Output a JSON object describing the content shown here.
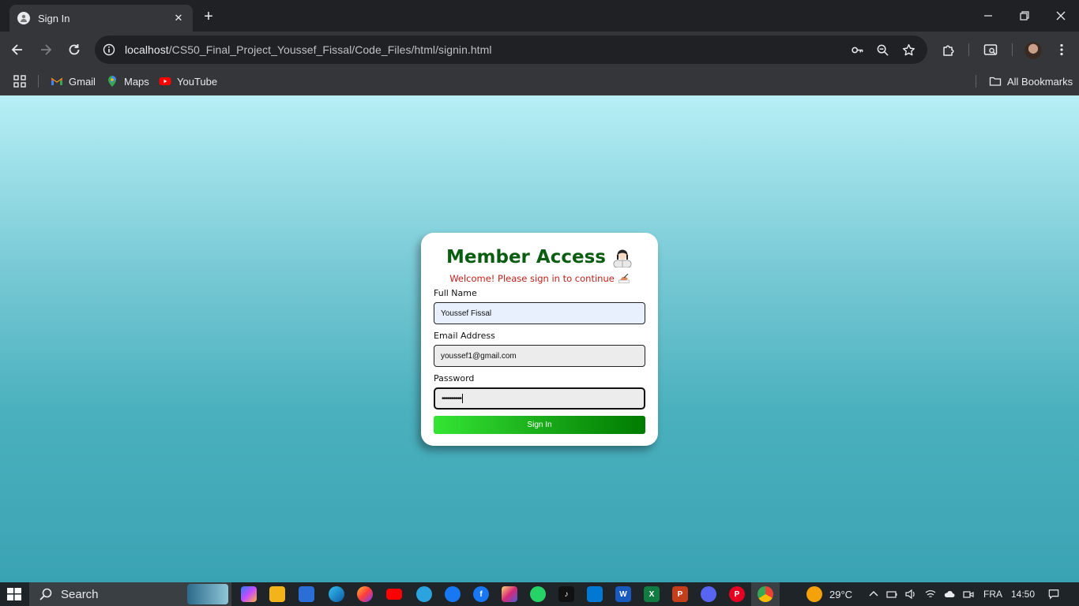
{
  "browser": {
    "tab_title": "Sign In",
    "url_host": "localhost",
    "url_path": "/CS50_Final_Project_Youssef_Fissal/Code_Files/html/signin.html",
    "bookmarks": [
      {
        "label": "Gmail",
        "icon": "gmail-icon"
      },
      {
        "label": "Maps",
        "icon": "maps-icon"
      },
      {
        "label": "YouTube",
        "icon": "youtube-icon"
      }
    ],
    "all_bookmarks_label": "All Bookmarks"
  },
  "signin": {
    "title": "Member Access",
    "title_emoji": "person-icon",
    "subtitle": "Welcome! Please sign in to continue",
    "subtitle_emoji": "writing-hand-icon",
    "fields": {
      "full_name": {
        "label": "Full Name",
        "value": "Youssef Fissal"
      },
      "email": {
        "label": "Email Address",
        "value": "youssef1@gmail.com"
      },
      "password": {
        "label": "Password",
        "value": "••••••••••"
      }
    },
    "submit_label": "Sign In",
    "colors": {
      "title": "#0b5d12",
      "subtitle": "#c0201a",
      "button_start": "#34e534",
      "button_end": "#007b00"
    }
  },
  "taskbar": {
    "search_placeholder": "Search",
    "weather": "29°C",
    "language": "FRA",
    "time": "14:50"
  }
}
